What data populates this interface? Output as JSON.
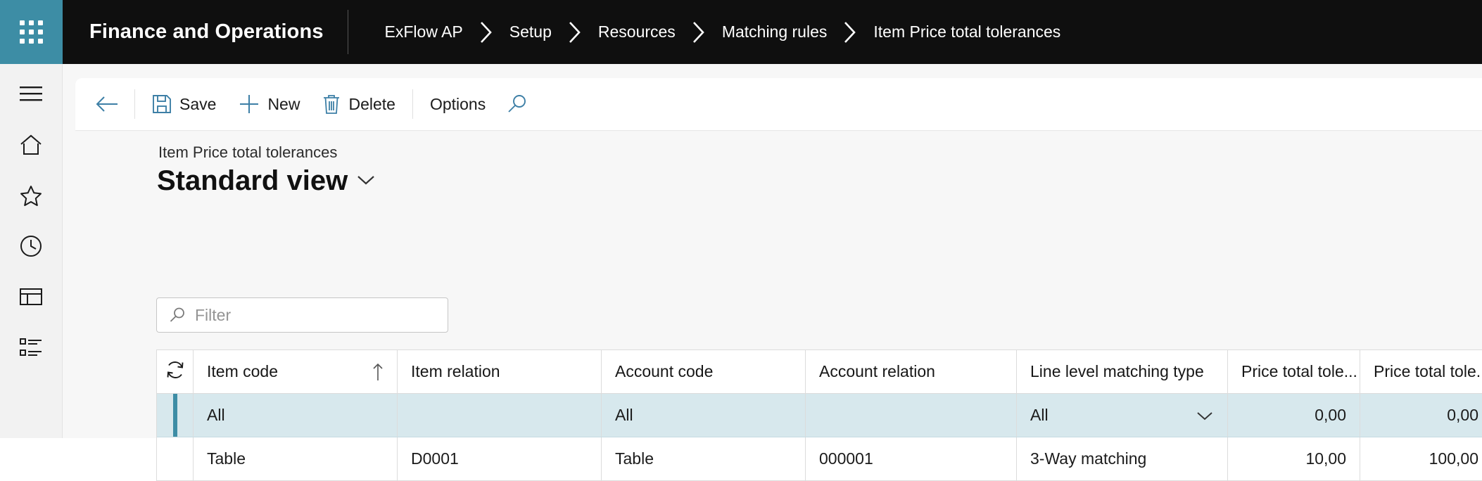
{
  "topbar": {
    "waffle_label": "app-launcher",
    "app_title": "Finance and Operations",
    "breadcrumb": [
      {
        "label": "ExFlow AP"
      },
      {
        "label": "Setup"
      },
      {
        "label": "Resources"
      },
      {
        "label": "Matching rules"
      },
      {
        "label": "Item Price total tolerances"
      }
    ],
    "separator": "›",
    "accent_color": "#3d8da5",
    "background_color": "#0f0f0f"
  },
  "rail": {
    "items": [
      {
        "name": "hamburger",
        "label": "Expand the navigation pane"
      },
      {
        "name": "home",
        "label": "Home"
      },
      {
        "name": "favorites",
        "label": "Favorites"
      },
      {
        "name": "recent",
        "label": "Recent"
      },
      {
        "name": "workspaces",
        "label": "Workspaces"
      },
      {
        "name": "modules",
        "label": "Modules"
      }
    ]
  },
  "actionpane": {
    "back_label": "Back",
    "save_label": "Save",
    "new_label": "New",
    "delete_label": "Delete",
    "options_label": "Options",
    "search_label": "Search",
    "icon_color": "#3d7fa6"
  },
  "page": {
    "caption": "Item Price total tolerances",
    "view_name": "Standard view"
  },
  "filter": {
    "placeholder": "Filter",
    "value": ""
  },
  "grid": {
    "columns": [
      {
        "key": "item_code",
        "label": "Item code",
        "sorted": true,
        "sort_dir": "↑"
      },
      {
        "key": "item_relation",
        "label": "Item relation"
      },
      {
        "key": "account_code",
        "label": "Account code"
      },
      {
        "key": "account_relation",
        "label": "Account relation"
      },
      {
        "key": "line_level_matching_type",
        "label": "Line level matching type"
      },
      {
        "key": "price_total_tolerance_1",
        "label": "Price total tole..."
      },
      {
        "key": "price_total_tolerance_2",
        "label": "Price total tole..."
      }
    ],
    "rows": [
      {
        "selected": true,
        "item_code": "All",
        "item_relation": "",
        "account_code": "All",
        "account_relation": "",
        "line_level_matching_type": "All",
        "price_total_tolerance_1": "0,00",
        "price_total_tolerance_2": "0,00"
      },
      {
        "selected": false,
        "item_code": "Table",
        "item_relation": "D0001",
        "account_code": "Table",
        "account_relation": "000001",
        "line_level_matching_type": "3-Way matching",
        "price_total_tolerance_1": "10,00",
        "price_total_tolerance_2": "100,00"
      }
    ],
    "selected_row_color": "#d7e8ed",
    "selection_bar_color": "#3d8da5",
    "refresh_label": "Refresh"
  }
}
